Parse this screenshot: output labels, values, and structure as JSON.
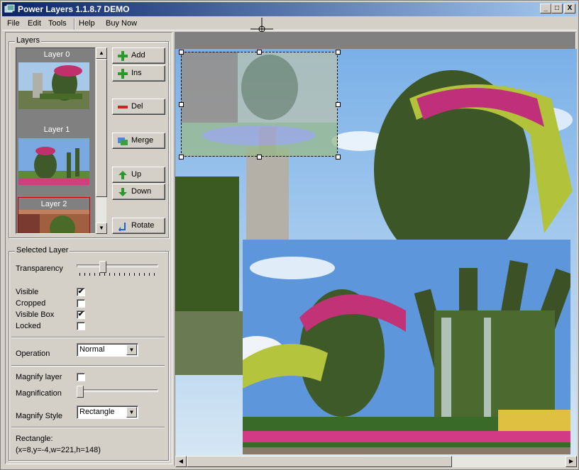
{
  "window": {
    "title": "Power Layers 1.1.8.7 DEMO",
    "min": "_",
    "max": "□",
    "close": "X"
  },
  "menu": {
    "items": [
      "File",
      "Edit",
      "Tools",
      "Help",
      "Buy Now"
    ]
  },
  "layers_group": {
    "label": "Layers",
    "layers": [
      "Layer 0",
      "Layer 1",
      "Layer 2"
    ]
  },
  "buttons": {
    "add": "Add",
    "ins": "Ins",
    "del": "Del",
    "merge": "Merge",
    "up": "Up",
    "down": "Down",
    "rotate": "Rotate"
  },
  "selected": {
    "label": "Selected Layer",
    "transparency_label": "Transparency",
    "transparency_value": 0.3,
    "visible_label": "Visible",
    "visible": true,
    "cropped_label": "Cropped",
    "cropped": false,
    "visiblebox_label": "Visible Box",
    "visiblebox": true,
    "locked_label": "Locked",
    "locked": false,
    "operation_label": "Operation",
    "operation": "Normal",
    "magnify_label": "Magnify layer",
    "magnify": false,
    "magnification_label": "Magnification",
    "magnification_value": 0.0,
    "magstyle_label": "Magnify Style",
    "magstyle": "Rectangle",
    "rect_label": "Rectangle:",
    "rect_value": "(x=8,y=-4,w=221,h=148)"
  },
  "colors": {
    "title_start": "#0a246a",
    "title_end": "#a6caf0",
    "selected_border": "#c00000"
  }
}
